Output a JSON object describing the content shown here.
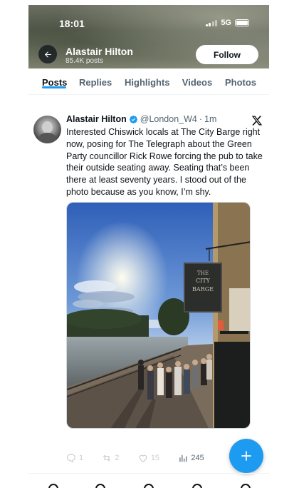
{
  "status_bar": {
    "time": "18:01",
    "network": "5G"
  },
  "profile": {
    "name": "Alastair Hilton",
    "posts_count": "85.4K posts",
    "follow_label": "Follow"
  },
  "tabs": [
    {
      "label": "Posts",
      "active": true
    },
    {
      "label": "Replies",
      "active": false
    },
    {
      "label": "Highlights",
      "active": false
    },
    {
      "label": "Videos",
      "active": false
    },
    {
      "label": "Photos",
      "active": false
    }
  ],
  "tweet": {
    "author": "Alastair Hilton",
    "handle": "@London_W4",
    "separator": "·",
    "time": "1m",
    "text": "Interested Chiswick locals at The City Barge right now, posing for The Telegraph about the Green Party councillor Rick Rowe forcing the pub to take their outside seating away. Seating that’s been there at least seventy years. I stood out of the photo because as you know, I’m shy.",
    "photo_sign": [
      "THE",
      "CITY",
      "BARGE"
    ],
    "stats": {
      "replies": "1",
      "reposts": "2",
      "likes": "15",
      "views": "245"
    }
  },
  "colors": {
    "accent": "#1d9bf0",
    "text": "#0f1419",
    "muted": "#536471"
  }
}
